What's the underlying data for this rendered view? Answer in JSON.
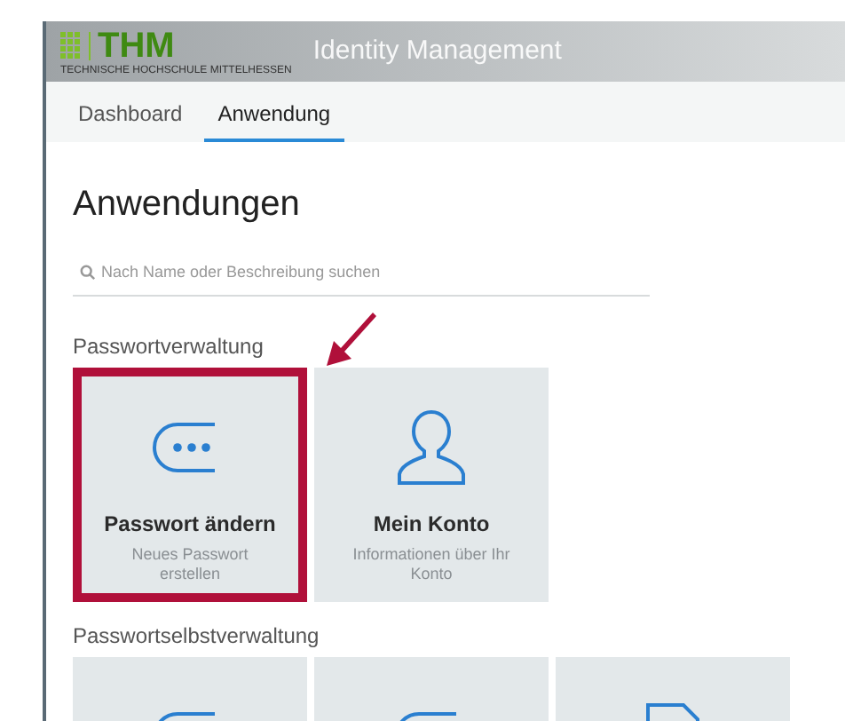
{
  "header": {
    "logo_text": "THM",
    "logo_subtitle": "TECHNISCHE HOCHSCHULE MITTELHESSEN",
    "title": "Identity Management"
  },
  "tabs": [
    {
      "label": "Dashboard",
      "selected": false
    },
    {
      "label": "Anwendung",
      "selected": true
    }
  ],
  "page_title": "Anwendungen",
  "search": {
    "placeholder": "Nach Name oder Beschreibung suchen"
  },
  "sections": [
    {
      "title": "Passwortverwaltung",
      "tiles": [
        {
          "kind": "dots",
          "title": "Passwort ändern",
          "description": "Neues Passwort erstellen",
          "highlighted": true
        },
        {
          "kind": "person",
          "title": "Mein Konto",
          "description": "Informationen über Ihr Konto",
          "highlighted": false
        }
      ]
    },
    {
      "title": "Passwortselbstverwaltung",
      "tiles": [
        {
          "kind": "dots",
          "highlighted": false
        },
        {
          "kind": "dots",
          "highlighted": false
        },
        {
          "kind": "document",
          "highlighted": false
        }
      ]
    }
  ]
}
